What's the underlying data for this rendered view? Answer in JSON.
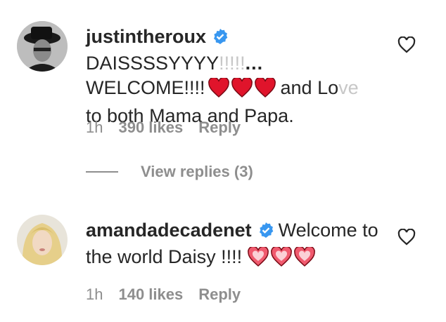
{
  "comments": [
    {
      "username": "justintheroux",
      "text_start": "DAISSSSYYYY",
      "text_fade": "!!!!!",
      "ellipsis": "...",
      "line2_start": "WELCOME!!!!",
      "line2_end": "and Lo",
      "line2_fade": "ve",
      "line3": "to both Mama and Papa.",
      "time": "1h",
      "likes": "390 likes",
      "reply": "Reply"
    },
    {
      "username": "amandadecadenet",
      "text": "Welcome to",
      "line2": "the world Daisy !!!!",
      "time": "1h",
      "likes": "140 likes",
      "reply": "Reply"
    }
  ],
  "view_replies": "View replies (3)",
  "icons": {
    "verified": "verified-badge-icon",
    "heart_emoji": "red-heart-emoji",
    "like": "heart-outline-icon"
  },
  "colors": {
    "verified_blue": "#3897f0",
    "heart_red": "#e0142b",
    "secondary_text": "#8e8e8e"
  }
}
